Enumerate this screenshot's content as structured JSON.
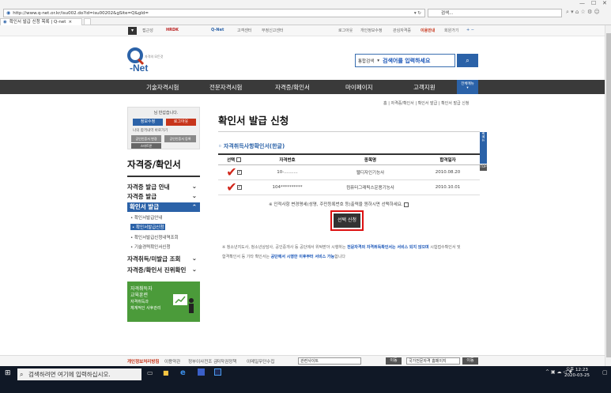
{
  "browser": {
    "url": "http://www.q-net.or.kr/isu002.do?id=isu00202&gSite=Q&gId=",
    "search_placeholder": "검색...",
    "tab_title": "확인서 발급 신청 목록 | Q-net"
  },
  "topbar": {
    "links": [
      "접근성",
      "HRDK",
      "Q-Net",
      "고객센터",
      "부정신고센터",
      "로그아웃",
      "개인정보수정",
      "관심자격증",
      "이용안내",
      "회원가기"
    ]
  },
  "header": {
    "logo_text": "Q-Net",
    "logo_sub": "자격의 모든것",
    "search_scope": "통합검색",
    "search_placeholder": "검색어를 입력하세요"
  },
  "nav": {
    "items": [
      "기술자격시험",
      "전문자격시험",
      "자격증/확인서",
      "마이페이지",
      "고객지원"
    ],
    "all_menu": "전체메뉴"
  },
  "loginbox": {
    "greeting": "님 반갑습니다.",
    "edit_btn": "정보수정",
    "logout_btn": "로그아웃",
    "note": "나의 합격내역 바로가기",
    "btn1": "공인인증서 변경",
    "btn2": "공인인증서 등록",
    "btn3": "스마트폰"
  },
  "sidebar": {
    "title": "자격증/확인서",
    "menus": [
      "자격증 발급 안내",
      "자격증 발급",
      "확인서 발급"
    ],
    "submenus": [
      "확인서발급안내",
      "확인서발급신청",
      "확인서발급신청내역조회",
      "기술경력확인서신청"
    ],
    "menus2": [
      "자격취득/미발급 조회",
      "자격증/확인서 진위확인"
    ],
    "banner_lines": [
      "자격취득자",
      "교육훈련",
      "자격취득과",
      "체계적인 사후관리"
    ]
  },
  "main": {
    "breadcrumb": "홈 | 자격증/확인서 | 확인서 발급 | 확인서 발급 신청",
    "title": "확인서 발급 신청",
    "section_title": "자격취득사항확인서(한글)",
    "columns": [
      "선택",
      "자격번호",
      "종목명",
      "합격일자"
    ],
    "rows": [
      {
        "number": "10-..........",
        "name": "웹디자인기능사",
        "date": "2010.08.20"
      },
      {
        "number": "104**********",
        "name": "컴퓨터그래픽스운용기능사",
        "date": "2010.10.01"
      }
    ],
    "notice": "※ 인적사항 변경명세(성명, 주민등록번호 등)출력을 원하시면 선택하세요.",
    "apply_btn": "선택 신청",
    "info_line1": "※ 청소년지도사, 청소년상담사, 공인중개사 등 공단에서 위탁받아 시행하는 ",
    "info_bold1": "전문자격의 자격취득확인서는 서비스 되지 않으며",
    "info_line1b": " 시험접수확인서 및",
    "info_line2": "합격확인서 등 기타 확인서는 ",
    "info_bold2": "공단에서 시행한 이후부터 서비스 가능",
    "info_line2b": "합니다"
  },
  "quickmenu": {
    "label": "퀵메뉴",
    "top": "TOP"
  },
  "footer": {
    "privacy": "개인정보처리방침",
    "terms": "이용약관",
    "mail": "정부이사전조 금",
    "links": [
      "저작권정책",
      "이메일무단수집"
    ],
    "select1": "관련사이트",
    "select2": "국가전문자격 홈페이지",
    "go": "이동"
  },
  "taskbar": {
    "search_placeholder": "검색하려면 여기에 입력하십시오.",
    "time": "오후 12:23",
    "date": "2020-03-25"
  },
  "colors": {
    "accent": "#2b62a8",
    "nav_bg": "#3a3a3a",
    "red": "#c7351b",
    "green": "#4b9b3a"
  }
}
